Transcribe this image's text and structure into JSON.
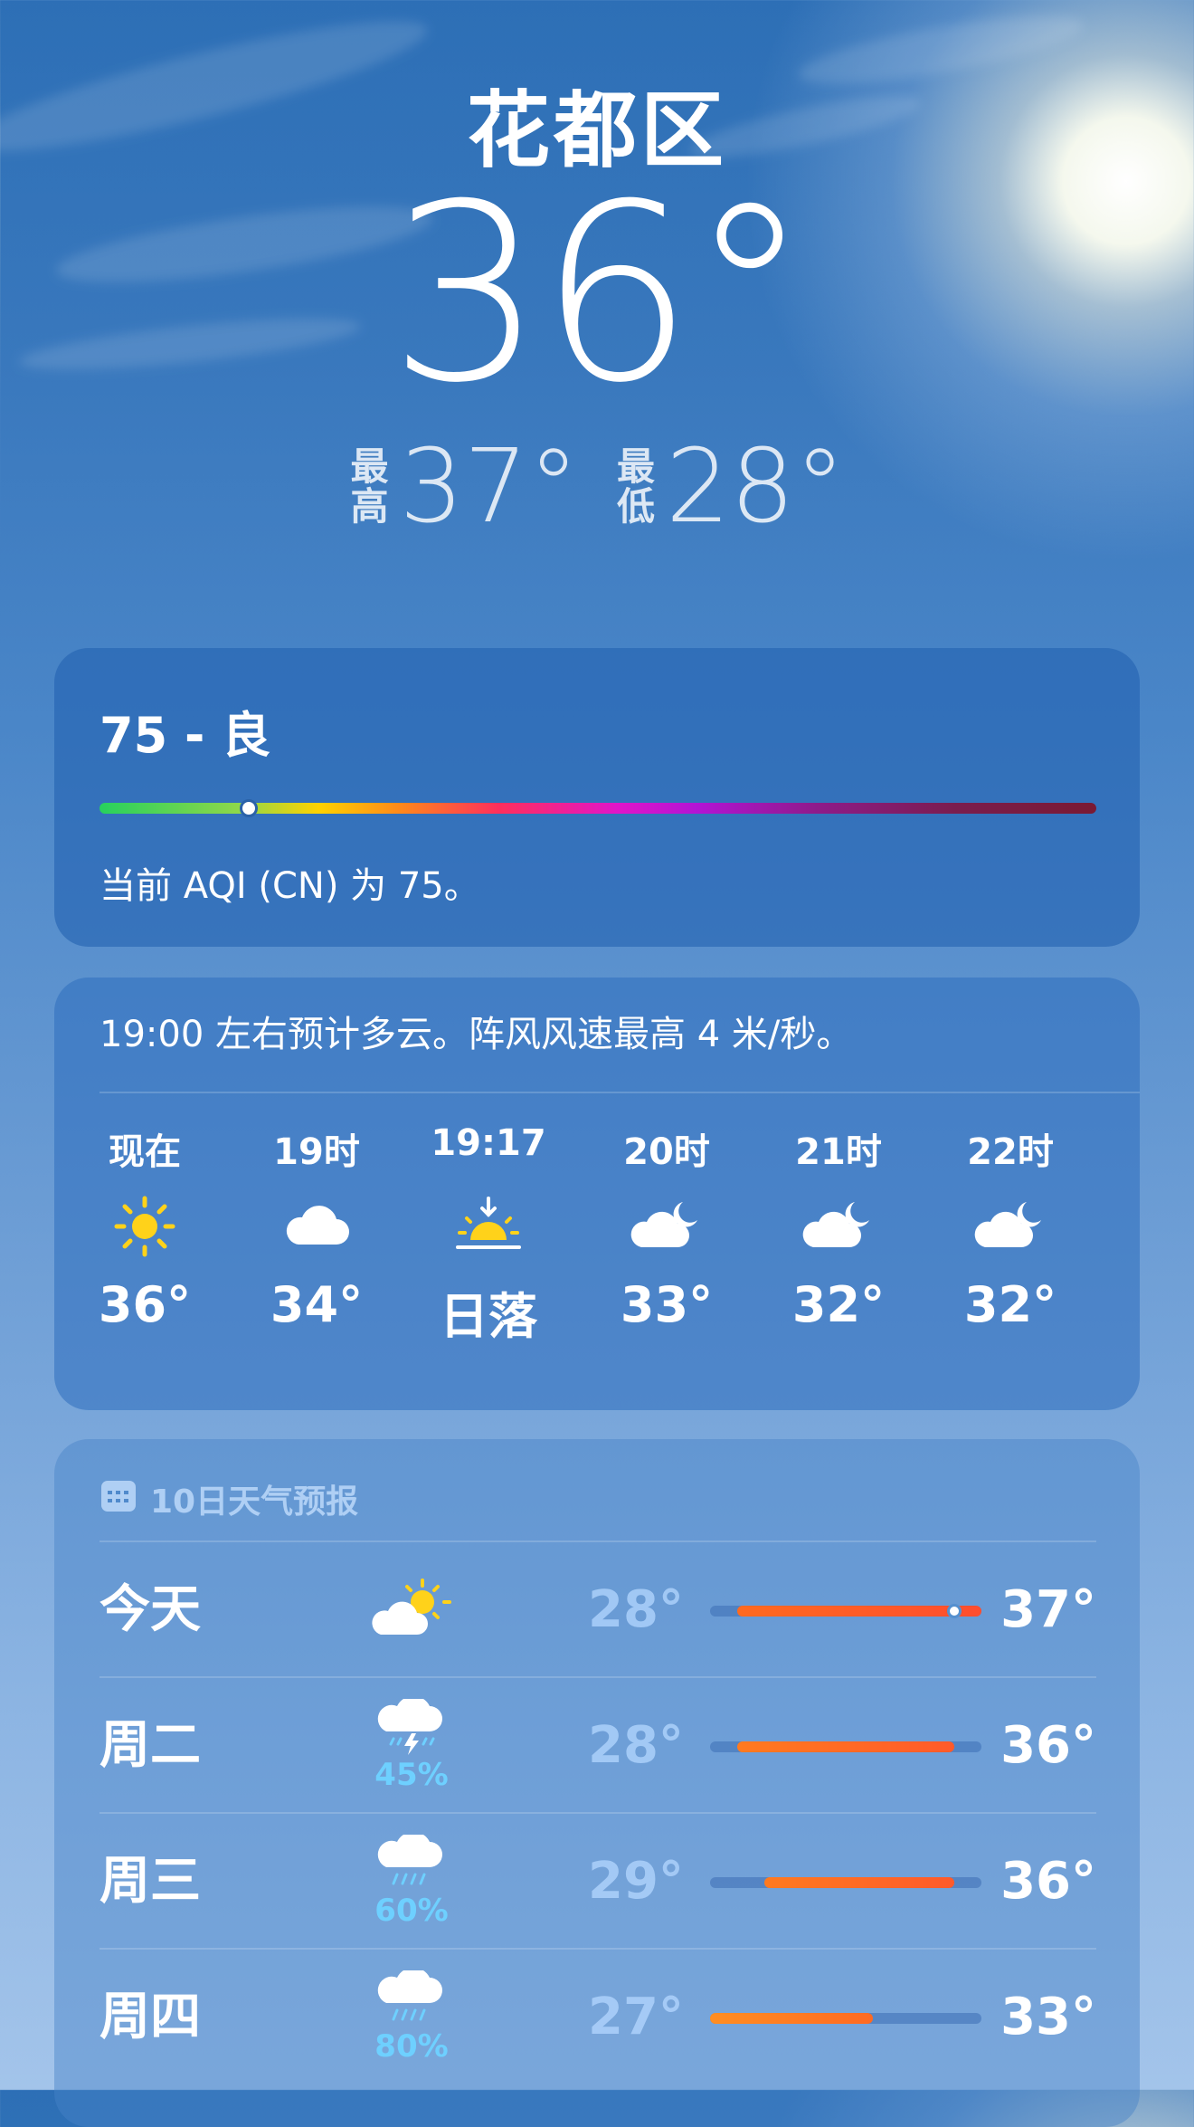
{
  "header": {
    "location": "花都区",
    "current_temp": "36°",
    "high_tag": "最高",
    "high_temp": "37°",
    "low_tag": "最低",
    "low_temp": "28°"
  },
  "aqi": {
    "title": "75 - 良",
    "description": "当前 AQI (CN) 为 75。",
    "level_fraction": 0.15
  },
  "hourly": {
    "summary": "19:00 左右预计多云。阵风风速最高 4 米/秒。",
    "items": [
      {
        "label": "现在",
        "icon": "sun-icon",
        "temp": "36°"
      },
      {
        "label": "19时",
        "icon": "cloud-icon",
        "temp": "34°"
      },
      {
        "label": "19:17",
        "icon": "sunset-icon",
        "temp": "日落"
      },
      {
        "label": "20时",
        "icon": "cloudy-night-icon",
        "temp": "33°"
      },
      {
        "label": "21时",
        "icon": "cloudy-night-icon",
        "temp": "32°"
      },
      {
        "label": "22时",
        "icon": "cloudy-night-icon",
        "temp": "32°"
      }
    ]
  },
  "daily": {
    "title": "10日天气预报",
    "range_min": 27,
    "range_max": 37,
    "days": [
      {
        "name": "今天",
        "icon": "partly-cloudy-icon",
        "prob": "",
        "low": "28°",
        "high": "37°",
        "low_val": 28,
        "high_val": 37,
        "current_val": 36,
        "fill_from": "#ff6a1f",
        "fill_to": "#ff4d2e"
      },
      {
        "name": "周二",
        "icon": "thunderstorm-icon",
        "prob": "45%",
        "low": "28°",
        "high": "36°",
        "low_val": 28,
        "high_val": 36,
        "fill_from": "#ff7a1f",
        "fill_to": "#ff5a2a"
      },
      {
        "name": "周三",
        "icon": "rain-icon",
        "prob": "60%",
        "low": "29°",
        "high": "36°",
        "low_val": 29,
        "high_val": 36,
        "fill_from": "#ff7a1f",
        "fill_to": "#ff5a2a"
      },
      {
        "name": "周四",
        "icon": "rain-icon",
        "prob": "80%",
        "low": "27°",
        "high": "33°",
        "low_val": 27,
        "high_val": 33,
        "fill_from": "#ff8e22",
        "fill_to": "#ff6a22"
      }
    ]
  },
  "colors": {
    "sun": "#ffd21a",
    "accent_orange": "#ff6a1f",
    "precip": "#6ed0ff"
  }
}
